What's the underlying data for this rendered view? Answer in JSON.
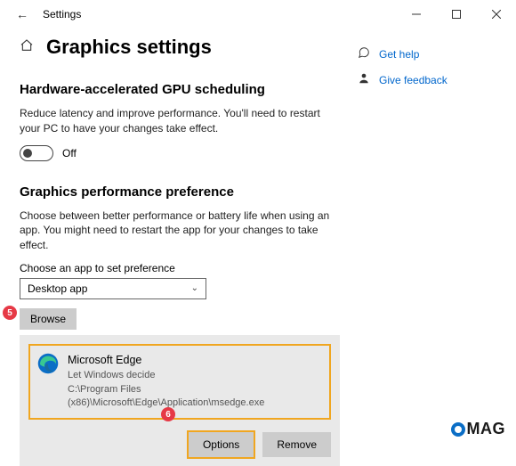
{
  "titlebar": {
    "app_title": "Settings"
  },
  "page": {
    "title": "Graphics settings"
  },
  "section1": {
    "heading": "Hardware-accelerated GPU scheduling",
    "description": "Reduce latency and improve performance. You'll need to restart your PC to have your changes take effect.",
    "toggle_state": "Off"
  },
  "section2": {
    "heading": "Graphics performance preference",
    "description": "Choose between better performance or battery life when using an app. You might need to restart the app for your changes to take effect.",
    "field_label": "Choose an app to set preference",
    "select_value": "Desktop app",
    "browse_label": "Browse"
  },
  "app": {
    "name": "Microsoft Edge",
    "pref": "Let Windows decide",
    "path": "C:\\Program Files (x86)\\Microsoft\\Edge\\Application\\msedge.exe",
    "options_label": "Options",
    "remove_label": "Remove"
  },
  "side": {
    "help": "Get help",
    "feedback": "Give feedback"
  },
  "badges": {
    "b5": "5",
    "b6": "6"
  },
  "watermark": "MAG"
}
